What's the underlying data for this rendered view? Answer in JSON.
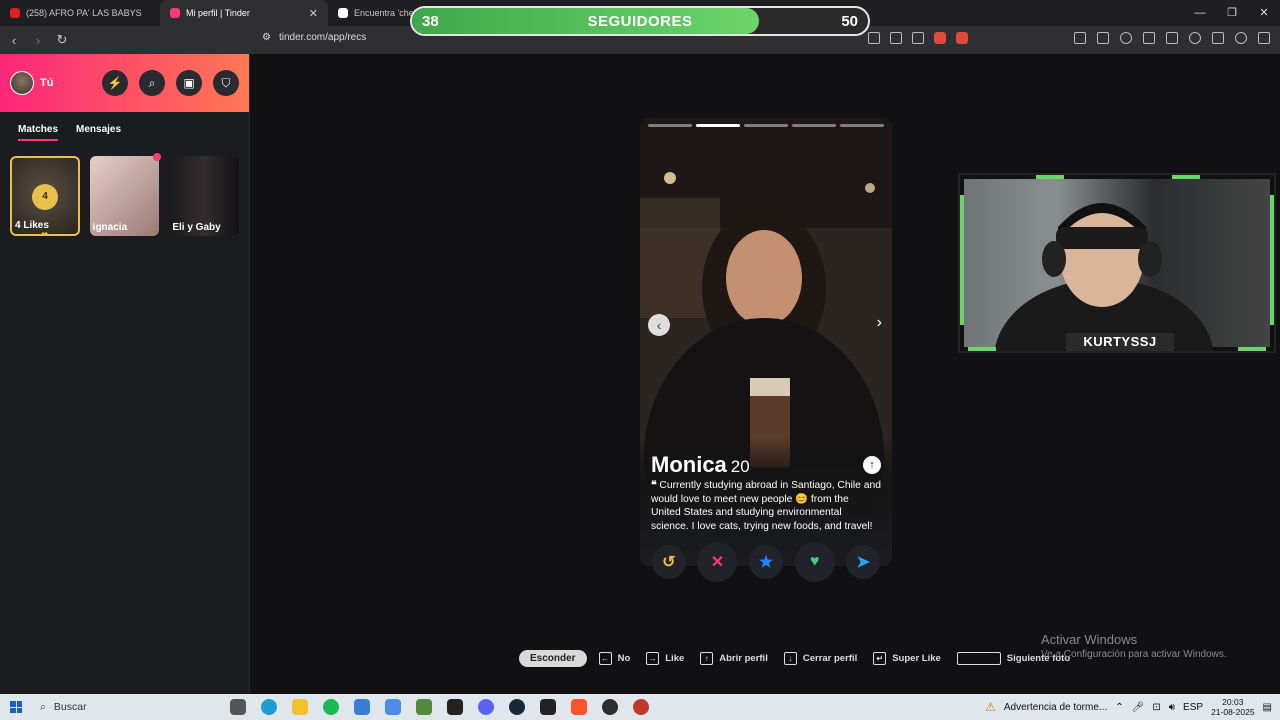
{
  "browser": {
    "tabs": [
      {
        "label": "(258) AFRO PA' LAS BABYS",
        "favicon_color": "#e02020"
      },
      {
        "label": "Mi perfil | Tinder",
        "favicon_color": "#fd3a72"
      },
      {
        "label": "Encuentra 'cheba",
        "favicon_color": "#ffffff"
      }
    ],
    "url": "tinder.com/app/recs"
  },
  "overlay": {
    "current": "38",
    "label": "SEGUIDORES",
    "goal": "50",
    "progress": 0.76
  },
  "sidebar": {
    "user_label": "Tú",
    "tabs": [
      "Matches",
      "Mensajes"
    ],
    "matches": [
      {
        "name": "4 Likes",
        "badge": "4"
      },
      {
        "name": "ignacia"
      },
      {
        "name": "Eli y Gaby"
      }
    ]
  },
  "profile": {
    "name": "Monica",
    "age": "20",
    "bio": "Currently studying abroad in Santiago, Chile and would love to meet new people 😊 from the United States and studying environmental science. I love cats, trying new foods, and travel!",
    "photo_count": 5,
    "photo_index": 2
  },
  "actions": [
    {
      "name": "rewind",
      "glyph": "↺",
      "color": "#f5b748"
    },
    {
      "name": "nope",
      "glyph": "✕",
      "color": "#fd3a73"
    },
    {
      "name": "super-like",
      "glyph": "★",
      "color": "#1786ff"
    },
    {
      "name": "like",
      "glyph": "♥",
      "color": "#3ad07a"
    },
    {
      "name": "boost",
      "glyph": "➤",
      "color": "#21a6ff"
    }
  ],
  "shortcuts": {
    "hide_label": "Esconder",
    "items": [
      {
        "key": "←",
        "label": "No"
      },
      {
        "key": "→",
        "label": "Like"
      },
      {
        "key": "↑",
        "label": "Abrir perfil"
      },
      {
        "key": "↓",
        "label": "Cerrar perfil"
      },
      {
        "key": "↵",
        "label": "Super Like"
      },
      {
        "key": "",
        "label": "Siguiente foto"
      }
    ]
  },
  "webcam": {
    "username": "KURTYSSJ"
  },
  "watermark": {
    "title": "Activar Windows",
    "subtitle": "Ve a Configuración para activar Windows."
  },
  "taskbar": {
    "search": "Buscar",
    "weather": "Advertencia de torme...",
    "lang": "ESP",
    "time": "20:03",
    "date": "21-08-2025"
  }
}
